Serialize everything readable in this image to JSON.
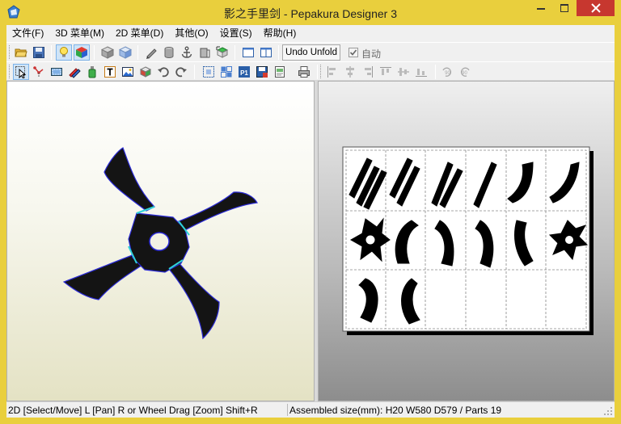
{
  "window": {
    "title": "影之手里剑 - Pepakura Designer 3"
  },
  "menu": [
    {
      "label": "文件(F)"
    },
    {
      "label": "3D 菜单(M)"
    },
    {
      "label": "2D 菜单(D)"
    },
    {
      "label": "其他(O)"
    },
    {
      "label": "设置(S)"
    },
    {
      "label": "帮助(H)"
    }
  ],
  "toolbar": {
    "undo_unfold_label": "Undo Unfold",
    "auto_label": "自动",
    "auto_checked": true
  },
  "status": {
    "hint": "2D [Select/Move] L [Pan] R or Wheel Drag [Zoom] Shift+R",
    "info": "Assembled size(mm): H20 W580 D579 / Parts 19"
  },
  "colors": {
    "titlebar": "#e9cf3d",
    "close": "#c7372f",
    "model_fill": "#141414",
    "model_edge": "#2b2bd6",
    "fold_line": "#2fd3d8",
    "part_fill": "#000000"
  },
  "icons": {
    "toolbar1": [
      "open-folder-icon",
      "save-icon",
      "light-bulb-icon",
      "colored-cube-icon",
      "gray-box-icon",
      "blue-box-icon",
      "pencil-icon",
      "cylinder-icon",
      "anchor-icon",
      "bag-icon",
      "cube-arrow-icon",
      "single-view-icon",
      "dual-view-icon"
    ],
    "toolbar2": [
      "select-arrow-icon",
      "edge-edit-icon",
      "texture-icon",
      "pencil-color-icon",
      "bottle-icon",
      "text-icon",
      "image-icon",
      "cube-move-icon",
      "rotate-left-icon",
      "rotate-right-icon",
      "select-box-icon",
      "arrange-icon",
      "page-p1-icon",
      "print-save-icon",
      "page-setup-icon",
      "printer-icon",
      "align-left-icon",
      "align-center-icon",
      "align-right-icon",
      "align-top-icon",
      "align-middle-icon",
      "align-bottom-icon",
      "rotate-90-left-icon",
      "rotate-90-right-icon"
    ]
  }
}
